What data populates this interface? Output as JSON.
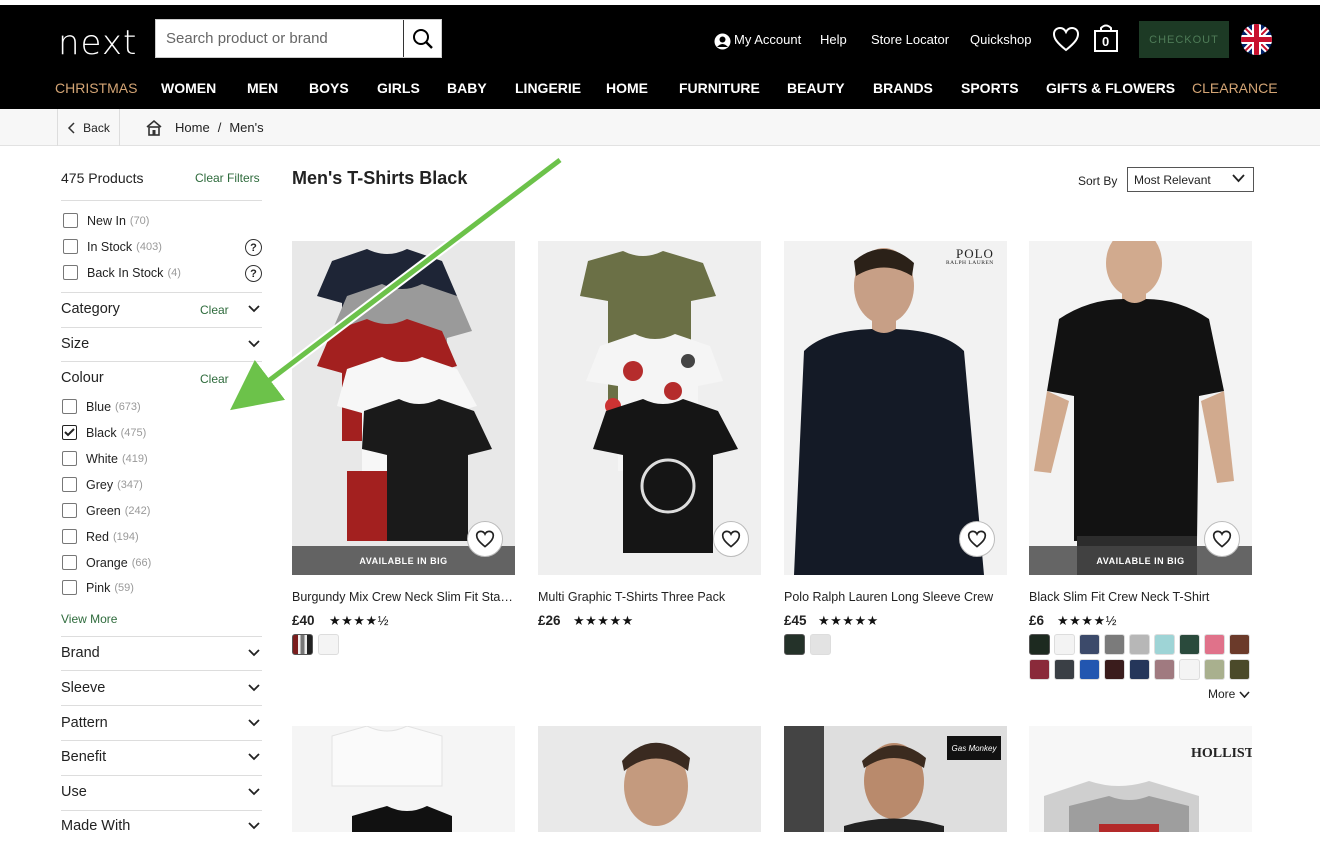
{
  "header": {
    "logo": "next",
    "search_placeholder": "Search product or brand",
    "links": [
      "My Account",
      "Help",
      "Store Locator",
      "Quickshop"
    ],
    "bag_count": "0",
    "checkout": "CHECKOUT"
  },
  "nav": [
    "CHRISTMAS",
    "WOMEN",
    "MEN",
    "BOYS",
    "GIRLS",
    "BABY",
    "LINGERIE",
    "HOME",
    "FURNITURE",
    "BEAUTY",
    "BRANDS",
    "SPORTS",
    "GIFTS & FLOWERS",
    "CLEARANCE"
  ],
  "breadcrumb": {
    "back": "Back",
    "home": "Home",
    "sep": "/",
    "current": "Men's"
  },
  "filters": {
    "count": "475 Products",
    "clear_filters": "Clear Filters",
    "availability": [
      {
        "label": "New In",
        "count": "(70)"
      },
      {
        "label": "In Stock",
        "count": "(403)"
      },
      {
        "label": "Back In Stock",
        "count": "(4)"
      }
    ],
    "sections": {
      "category": "Category",
      "size": "Size",
      "colour": "Colour",
      "clear": "Clear",
      "brand": "Brand",
      "sleeve": "Sleeve",
      "pattern": "Pattern",
      "benefit": "Benefit",
      "use": "Use",
      "made_with": "Made With"
    },
    "colours": [
      {
        "label": "Blue",
        "count": "(673)",
        "checked": false
      },
      {
        "label": "Black",
        "count": "(475)",
        "checked": true
      },
      {
        "label": "White",
        "count": "(419)",
        "checked": false
      },
      {
        "label": "Grey",
        "count": "(347)",
        "checked": false
      },
      {
        "label": "Green",
        "count": "(242)",
        "checked": false
      },
      {
        "label": "Red",
        "count": "(194)",
        "checked": false
      },
      {
        "label": "Orange",
        "count": "(66)",
        "checked": false
      },
      {
        "label": "Pink",
        "count": "(59)",
        "checked": false
      }
    ],
    "view_more": "View More"
  },
  "main": {
    "title": "Men's T-Shirts Black",
    "sort_label": "Sort By",
    "sort_value": "Most Relevant",
    "more": "More"
  },
  "products": [
    {
      "name": "Burgundy Mix Crew Neck Slim Fit Stag ...",
      "price": "£40",
      "stars": "★★★★½",
      "badge": "AVAILABLE IN BIG"
    },
    {
      "name": "Multi Graphic T-Shirts Three Pack",
      "price": "£26",
      "stars": "★★★★★",
      "badge": ""
    },
    {
      "name": "Polo Ralph Lauren Long Sleeve Crew",
      "price": "£45",
      "stars": "★★★★★",
      "badge": "",
      "brand_mark": "POLO",
      "brand_sub": "RALPH LAUREN"
    },
    {
      "name": "Black Slim Fit Crew Neck T-Shirt",
      "price": "£6",
      "stars": "★★★★½",
      "badge": "AVAILABLE IN BIG"
    }
  ],
  "second_row_brands": [
    "Gas Monkey",
    "HOLLISTER"
  ],
  "colors": {
    "accent_green": "#2e6b3c",
    "nav_accent": "#d4a575",
    "arrow": "#6cc24a"
  }
}
